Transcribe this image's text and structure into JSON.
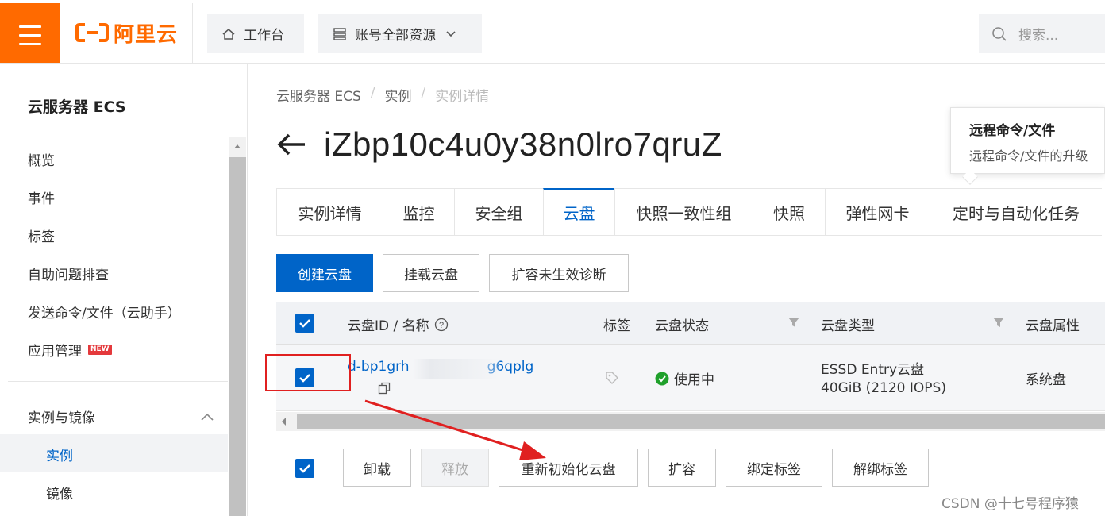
{
  "brand": {
    "logo_text": "阿里云",
    "accent": "#ff6a00"
  },
  "topbar": {
    "workbench_label": "工作台",
    "resources_label": "账号全部资源",
    "search_placeholder": "搜索..."
  },
  "sidebar": {
    "title": "云服务器 ECS",
    "items": [
      {
        "label": "概览"
      },
      {
        "label": "事件"
      },
      {
        "label": "标签"
      },
      {
        "label": "自助问题排查"
      },
      {
        "label": "发送命令/文件（云助手）"
      },
      {
        "label": "应用管理",
        "badge": "NEW"
      }
    ],
    "group_label": "实例与镜像",
    "sub_items": [
      {
        "label": "实例",
        "active": true
      },
      {
        "label": "镜像"
      }
    ]
  },
  "breadcrumb": [
    "云服务器 ECS",
    "实例",
    "实例详情"
  ],
  "instance_id": "iZbp10c4u0y38n0lro7qruZ",
  "tooltip": {
    "title": "远程命令/文件",
    "text": "远程命令/文件的升级"
  },
  "tabs": [
    {
      "label": "实例详情"
    },
    {
      "label": "监控"
    },
    {
      "label": "安全组"
    },
    {
      "label": "云盘",
      "active": true
    },
    {
      "label": "快照一致性组"
    },
    {
      "label": "快照"
    },
    {
      "label": "弹性网卡"
    },
    {
      "label": "定时与自动化任务"
    }
  ],
  "actions": {
    "create": "创建云盘",
    "attach": "挂载云盘",
    "diagnose": "扩容未生效诊断"
  },
  "table": {
    "headers": {
      "id_name": "云盘ID / 名称",
      "tags": "标签",
      "status": "云盘状态",
      "type": "云盘类型",
      "attribute": "云盘属性"
    },
    "rows": [
      {
        "disk_id": "d-bp1grh",
        "disk_id_tail": "g6qplg",
        "status": "使用中",
        "type": "ESSD Entry云盘",
        "spec": "40GiB (2120 IOPS)",
        "attribute": "系统盘",
        "checked": true
      }
    ]
  },
  "bulk_actions": {
    "detach": "卸载",
    "release": "释放",
    "reinit": "重新初始化云盘",
    "resize": "扩容",
    "bind_tag": "绑定标签",
    "unbind_tag": "解绑标签"
  },
  "watermark": "CSDN @十七号程序猿",
  "colors": {
    "primary": "#0064c8",
    "status_ok": "#1fa02b",
    "annotation": "#e02020"
  }
}
